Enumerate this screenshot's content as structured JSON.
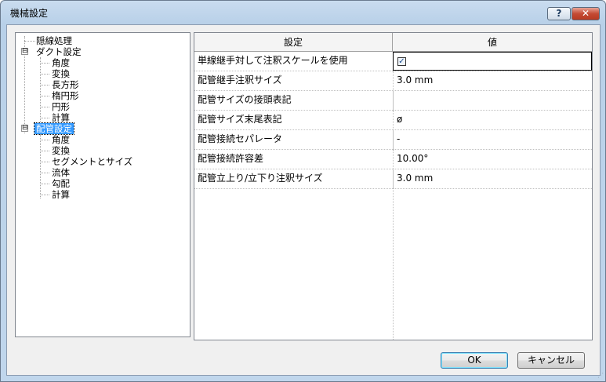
{
  "window": {
    "title": "機械設定",
    "help_label": "?",
    "close_label": "✕"
  },
  "tree": {
    "items": [
      {
        "label": "隠線処理"
      },
      {
        "label": "ダクト設定",
        "expander": "⊟"
      },
      {
        "label": "角度"
      },
      {
        "label": "変換"
      },
      {
        "label": "長方形"
      },
      {
        "label": "楕円形"
      },
      {
        "label": "円形"
      },
      {
        "label": "計算"
      },
      {
        "label": "配管設定",
        "expander": "⊟",
        "selected": true
      },
      {
        "label": "角度"
      },
      {
        "label": "変換"
      },
      {
        "label": "セグメントとサイズ"
      },
      {
        "label": "流体"
      },
      {
        "label": "勾配"
      },
      {
        "label": "計算"
      }
    ]
  },
  "grid": {
    "headers": {
      "setting": "設定",
      "value": "値"
    },
    "rows": [
      {
        "setting": "単線継手対して注釈スケールを使用",
        "value": "",
        "checked": true,
        "check_mark": "✓"
      },
      {
        "setting": "配管継手注釈サイズ",
        "value": "3.0 mm"
      },
      {
        "setting": "配管サイズの接頭表記",
        "value": ""
      },
      {
        "setting": "配管サイズ末尾表記",
        "value": "ø"
      },
      {
        "setting": "配管接続セパレータ",
        "value": "-"
      },
      {
        "setting": "配管接続許容差",
        "value": "10.00°"
      },
      {
        "setting": "配管立上り/立下り注釈サイズ",
        "value": "3.0 mm"
      }
    ]
  },
  "buttons": {
    "ok": "OK",
    "cancel": "キャンセル"
  }
}
